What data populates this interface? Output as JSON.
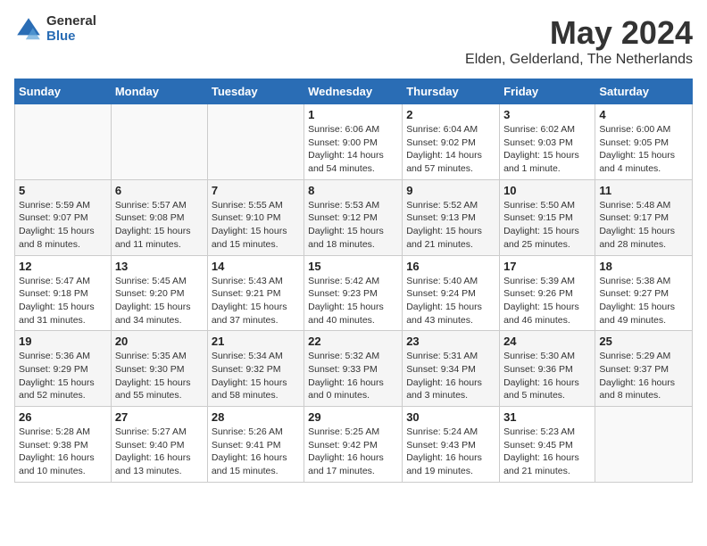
{
  "logo": {
    "general": "General",
    "blue": "Blue"
  },
  "header": {
    "month": "May 2024",
    "location": "Elden, Gelderland, The Netherlands"
  },
  "days_of_week": [
    "Sunday",
    "Monday",
    "Tuesday",
    "Wednesday",
    "Thursday",
    "Friday",
    "Saturday"
  ],
  "weeks": [
    [
      {
        "day": "",
        "info": ""
      },
      {
        "day": "",
        "info": ""
      },
      {
        "day": "",
        "info": ""
      },
      {
        "day": "1",
        "info": "Sunrise: 6:06 AM\nSunset: 9:00 PM\nDaylight: 14 hours\nand 54 minutes."
      },
      {
        "day": "2",
        "info": "Sunrise: 6:04 AM\nSunset: 9:02 PM\nDaylight: 14 hours\nand 57 minutes."
      },
      {
        "day": "3",
        "info": "Sunrise: 6:02 AM\nSunset: 9:03 PM\nDaylight: 15 hours\nand 1 minute."
      },
      {
        "day": "4",
        "info": "Sunrise: 6:00 AM\nSunset: 9:05 PM\nDaylight: 15 hours\nand 4 minutes."
      }
    ],
    [
      {
        "day": "5",
        "info": "Sunrise: 5:59 AM\nSunset: 9:07 PM\nDaylight: 15 hours\nand 8 minutes."
      },
      {
        "day": "6",
        "info": "Sunrise: 5:57 AM\nSunset: 9:08 PM\nDaylight: 15 hours\nand 11 minutes."
      },
      {
        "day": "7",
        "info": "Sunrise: 5:55 AM\nSunset: 9:10 PM\nDaylight: 15 hours\nand 15 minutes."
      },
      {
        "day": "8",
        "info": "Sunrise: 5:53 AM\nSunset: 9:12 PM\nDaylight: 15 hours\nand 18 minutes."
      },
      {
        "day": "9",
        "info": "Sunrise: 5:52 AM\nSunset: 9:13 PM\nDaylight: 15 hours\nand 21 minutes."
      },
      {
        "day": "10",
        "info": "Sunrise: 5:50 AM\nSunset: 9:15 PM\nDaylight: 15 hours\nand 25 minutes."
      },
      {
        "day": "11",
        "info": "Sunrise: 5:48 AM\nSunset: 9:17 PM\nDaylight: 15 hours\nand 28 minutes."
      }
    ],
    [
      {
        "day": "12",
        "info": "Sunrise: 5:47 AM\nSunset: 9:18 PM\nDaylight: 15 hours\nand 31 minutes."
      },
      {
        "day": "13",
        "info": "Sunrise: 5:45 AM\nSunset: 9:20 PM\nDaylight: 15 hours\nand 34 minutes."
      },
      {
        "day": "14",
        "info": "Sunrise: 5:43 AM\nSunset: 9:21 PM\nDaylight: 15 hours\nand 37 minutes."
      },
      {
        "day": "15",
        "info": "Sunrise: 5:42 AM\nSunset: 9:23 PM\nDaylight: 15 hours\nand 40 minutes."
      },
      {
        "day": "16",
        "info": "Sunrise: 5:40 AM\nSunset: 9:24 PM\nDaylight: 15 hours\nand 43 minutes."
      },
      {
        "day": "17",
        "info": "Sunrise: 5:39 AM\nSunset: 9:26 PM\nDaylight: 15 hours\nand 46 minutes."
      },
      {
        "day": "18",
        "info": "Sunrise: 5:38 AM\nSunset: 9:27 PM\nDaylight: 15 hours\nand 49 minutes."
      }
    ],
    [
      {
        "day": "19",
        "info": "Sunrise: 5:36 AM\nSunset: 9:29 PM\nDaylight: 15 hours\nand 52 minutes."
      },
      {
        "day": "20",
        "info": "Sunrise: 5:35 AM\nSunset: 9:30 PM\nDaylight: 15 hours\nand 55 minutes."
      },
      {
        "day": "21",
        "info": "Sunrise: 5:34 AM\nSunset: 9:32 PM\nDaylight: 15 hours\nand 58 minutes."
      },
      {
        "day": "22",
        "info": "Sunrise: 5:32 AM\nSunset: 9:33 PM\nDaylight: 16 hours\nand 0 minutes."
      },
      {
        "day": "23",
        "info": "Sunrise: 5:31 AM\nSunset: 9:34 PM\nDaylight: 16 hours\nand 3 minutes."
      },
      {
        "day": "24",
        "info": "Sunrise: 5:30 AM\nSunset: 9:36 PM\nDaylight: 16 hours\nand 5 minutes."
      },
      {
        "day": "25",
        "info": "Sunrise: 5:29 AM\nSunset: 9:37 PM\nDaylight: 16 hours\nand 8 minutes."
      }
    ],
    [
      {
        "day": "26",
        "info": "Sunrise: 5:28 AM\nSunset: 9:38 PM\nDaylight: 16 hours\nand 10 minutes."
      },
      {
        "day": "27",
        "info": "Sunrise: 5:27 AM\nSunset: 9:40 PM\nDaylight: 16 hours\nand 13 minutes."
      },
      {
        "day": "28",
        "info": "Sunrise: 5:26 AM\nSunset: 9:41 PM\nDaylight: 16 hours\nand 15 minutes."
      },
      {
        "day": "29",
        "info": "Sunrise: 5:25 AM\nSunset: 9:42 PM\nDaylight: 16 hours\nand 17 minutes."
      },
      {
        "day": "30",
        "info": "Sunrise: 5:24 AM\nSunset: 9:43 PM\nDaylight: 16 hours\nand 19 minutes."
      },
      {
        "day": "31",
        "info": "Sunrise: 5:23 AM\nSunset: 9:45 PM\nDaylight: 16 hours\nand 21 minutes."
      },
      {
        "day": "",
        "info": ""
      }
    ]
  ]
}
